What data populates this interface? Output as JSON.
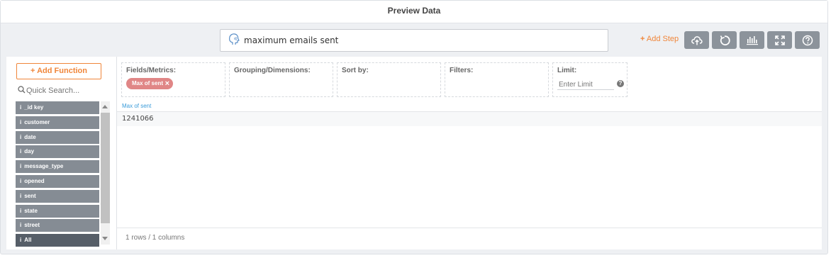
{
  "window": {
    "title": "Preview Data"
  },
  "query": {
    "text": "maximum emails sent"
  },
  "toolbar": {
    "add_step_plus": "+",
    "add_step_label": "Add Step",
    "buttons": [
      {
        "name": "upload-cloud-button",
        "icon": "cloud-upload-icon"
      },
      {
        "name": "refresh-button",
        "icon": "refresh-icon"
      },
      {
        "name": "chart-button",
        "icon": "bar-chart-icon"
      },
      {
        "name": "expand-button",
        "icon": "expand-icon"
      },
      {
        "name": "help-button",
        "icon": "question-icon"
      }
    ]
  },
  "left_panel": {
    "add_function_plus": "+",
    "add_function_label": "Add Function",
    "search_placeholder": "Quick Search...",
    "fields": [
      {
        "label": "_id key"
      },
      {
        "label": "customer"
      },
      {
        "label": "date"
      },
      {
        "label": "day"
      },
      {
        "label": "message_type"
      },
      {
        "label": "opened"
      },
      {
        "label": "sent"
      },
      {
        "label": "state"
      },
      {
        "label": "street"
      },
      {
        "label": "All"
      }
    ],
    "field_icon": "i"
  },
  "zones": {
    "fields": {
      "label": "Fields/Metrics:",
      "chips": [
        {
          "label": "Max of sent",
          "remove": "×"
        }
      ]
    },
    "grouping": {
      "label": "Grouping/Dimensions:"
    },
    "sort": {
      "label": "Sort by:"
    },
    "filters": {
      "label": "Filters:"
    },
    "limit": {
      "label": "Limit:",
      "placeholder": "Enter Limit",
      "help": "?"
    }
  },
  "table": {
    "columns": [
      "Max of sent"
    ],
    "rows": [
      [
        "1241066"
      ]
    ]
  },
  "footer": {
    "summary": "1 rows / 1 columns"
  },
  "colors": {
    "accent": "#f0863a",
    "chip": "#e08686",
    "button": "#8c939b",
    "field": "#858c94",
    "field_dark": "#565e68",
    "link": "#3a9bd9"
  }
}
